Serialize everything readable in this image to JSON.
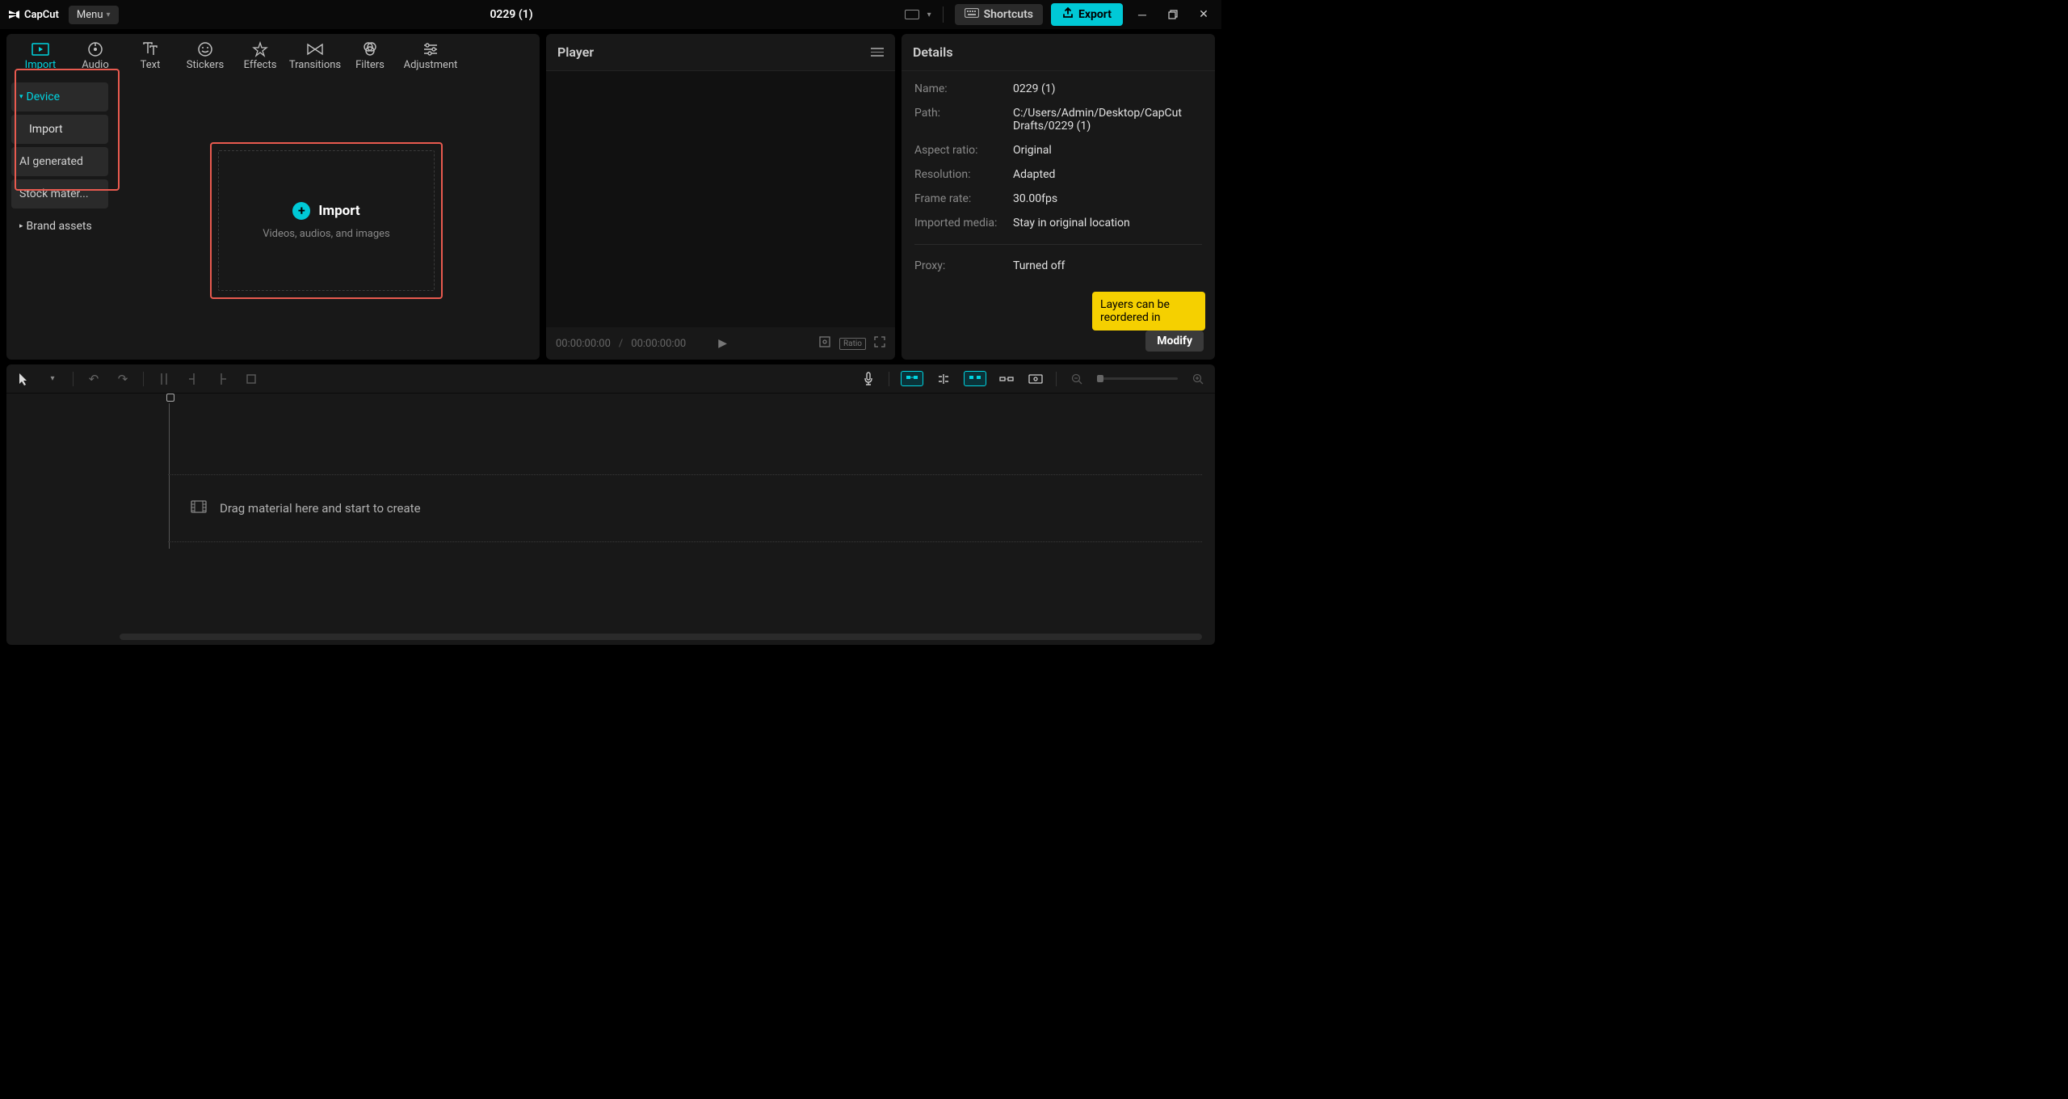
{
  "app": {
    "name": "CapCut",
    "menu_label": "Menu",
    "project_title": "0229 (1)",
    "shortcuts_label": "Shortcuts",
    "export_label": "Export"
  },
  "media_tabs": [
    {
      "label": "Import",
      "active": true
    },
    {
      "label": "Audio"
    },
    {
      "label": "Text"
    },
    {
      "label": "Stickers"
    },
    {
      "label": "Effects"
    },
    {
      "label": "Transitions"
    },
    {
      "label": "Filters"
    },
    {
      "label": "Adjustment"
    }
  ],
  "sidebar": {
    "device": "Device",
    "import": "Import",
    "ai": "AI generated",
    "stock": "Stock mater...",
    "brand": "Brand assets"
  },
  "drop": {
    "title": "Import",
    "subtitle": "Videos, audios, and images"
  },
  "player": {
    "title": "Player",
    "time_current": "00:00:00:00",
    "time_total": "00:00:00:00",
    "ratio_label": "Ratio"
  },
  "details": {
    "title": "Details",
    "rows": {
      "name_label": "Name:",
      "name_value": "0229 (1)",
      "path_label": "Path:",
      "path_value": "C:/Users/Admin/Desktop/CapCut Drafts/0229 (1)",
      "aspect_label": "Aspect ratio:",
      "aspect_value": "Original",
      "resolution_label": "Resolution:",
      "resolution_value": "Adapted",
      "framerate_label": "Frame rate:",
      "framerate_value": "30.00fps",
      "imported_label": "Imported media:",
      "imported_value": "Stay in original location",
      "proxy_label": "Proxy:",
      "proxy_value": "Turned off"
    },
    "modify_label": "Modify",
    "tooltip": "Layers can be reordered in"
  },
  "timeline": {
    "hint": "Drag material here and start to create"
  }
}
